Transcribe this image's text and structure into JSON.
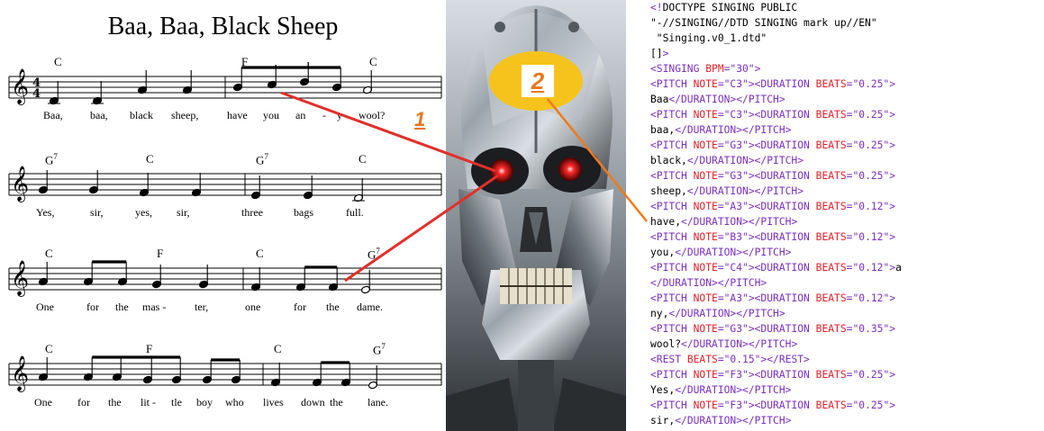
{
  "sheet": {
    "title": "Baa, Baa, Black Sheep",
    "time_signature": {
      "top": "4",
      "bottom": "4"
    },
    "rows": [
      {
        "chords": [
          {
            "label": "C",
            "sup": ""
          },
          {
            "label": "F",
            "sup": ""
          },
          {
            "label": "C",
            "sup": ""
          }
        ],
        "lyrics": [
          "Baa,",
          "baa,",
          "black",
          "sheep,",
          "have",
          "you",
          "an",
          "-",
          "y",
          "wool?"
        ]
      },
      {
        "chords": [
          {
            "label": "G",
            "sup": "7"
          },
          {
            "label": "C",
            "sup": ""
          },
          {
            "label": "G",
            "sup": "7"
          },
          {
            "label": "C",
            "sup": ""
          }
        ],
        "lyrics": [
          "Yes,",
          "sir,",
          "yes,",
          "sir,",
          "three",
          "bags",
          "full."
        ]
      },
      {
        "chords": [
          {
            "label": "C",
            "sup": ""
          },
          {
            "label": "F",
            "sup": ""
          },
          {
            "label": "C",
            "sup": ""
          },
          {
            "label": "G",
            "sup": "7"
          }
        ],
        "lyrics": [
          "One",
          "for",
          "the",
          "mas -",
          "ter,",
          "one",
          "for",
          "the",
          "dame."
        ]
      },
      {
        "chords": [
          {
            "label": "C",
            "sup": ""
          },
          {
            "label": "F",
            "sup": ""
          },
          {
            "label": "C",
            "sup": ""
          },
          {
            "label": "G",
            "sup": "7"
          }
        ],
        "lyrics": [
          "One",
          "for",
          "the",
          "lit -",
          "tle",
          "boy",
          "who",
          "lives",
          "down",
          "the",
          "lane."
        ]
      }
    ]
  },
  "markers": [
    {
      "label": "1",
      "color": "#e8761e"
    },
    {
      "label": "2",
      "color": "#e8761e",
      "badge_color": "#f5c31c"
    }
  ],
  "colors": {
    "tag": "#7a2fbf",
    "attribute": "#e0202a",
    "value": "#7a2fbf",
    "text": "#000000",
    "connector_red": "#e0302a",
    "connector_orange": "#f07a1a"
  },
  "robot": {
    "icon": "terminator-endoskeleton-image"
  },
  "xml_lines": [
    [
      {
        "t": "<!",
        "c": "tg"
      },
      {
        "t": "DOCTYPE SINGING PUBLIC",
        "c": "tx"
      }
    ],
    [
      {
        "t": "\"-//SINGING//DTD SINGING mark up//EN\"",
        "c": "tx"
      }
    ],
    [
      {
        "t": " \"Singing.v0_1.dtd\"",
        "c": "tx"
      }
    ],
    [
      {
        "t": "[]",
        "c": "tx"
      },
      {
        "t": ">",
        "c": "tg"
      }
    ],
    [
      {
        "t": "<SINGING ",
        "c": "tg"
      },
      {
        "t": "BPM",
        "c": "at"
      },
      {
        "t": "=\"30\">",
        "c": "av"
      }
    ],
    [
      {
        "t": "<PITCH ",
        "c": "tg"
      },
      {
        "t": "NOTE",
        "c": "at"
      },
      {
        "t": "=\"C3\"><DURATION ",
        "c": "av"
      },
      {
        "t": "BEATS",
        "c": "at"
      },
      {
        "t": "=\"0.25\">",
        "c": "av"
      }
    ],
    [
      {
        "t": "Baa",
        "c": "tx"
      },
      {
        "t": "</DURATION></PITCH>",
        "c": "tg"
      }
    ],
    [
      {
        "t": "<PITCH ",
        "c": "tg"
      },
      {
        "t": "NOTE",
        "c": "at"
      },
      {
        "t": "=\"C3\"><DURATION ",
        "c": "av"
      },
      {
        "t": "BEATS",
        "c": "at"
      },
      {
        "t": "=\"0.25\">",
        "c": "av"
      }
    ],
    [
      {
        "t": "baa,",
        "c": "tx"
      },
      {
        "t": "</DURATION></PITCH>",
        "c": "tg"
      }
    ],
    [
      {
        "t": "<PITCH ",
        "c": "tg"
      },
      {
        "t": "NOTE",
        "c": "at"
      },
      {
        "t": "=\"G3\"><DURATION ",
        "c": "av"
      },
      {
        "t": "BEATS",
        "c": "at"
      },
      {
        "t": "=\"0.25\">",
        "c": "av"
      }
    ],
    [
      {
        "t": "black,",
        "c": "tx"
      },
      {
        "t": "</DURATION></PITCH>",
        "c": "tg"
      }
    ],
    [
      {
        "t": "<PITCH ",
        "c": "tg"
      },
      {
        "t": "NOTE",
        "c": "at"
      },
      {
        "t": "=\"G3\"><DURATION ",
        "c": "av"
      },
      {
        "t": "BEATS",
        "c": "at"
      },
      {
        "t": "=\"0.25\">",
        "c": "av"
      }
    ],
    [
      {
        "t": "sheep,",
        "c": "tx"
      },
      {
        "t": "</DURATION></PITCH>",
        "c": "tg"
      }
    ],
    [
      {
        "t": "<PITCH ",
        "c": "tg"
      },
      {
        "t": "NOTE",
        "c": "at"
      },
      {
        "t": "=\"A3\"><DURATION ",
        "c": "av"
      },
      {
        "t": "BEATS",
        "c": "at"
      },
      {
        "t": "=\"0.12\">",
        "c": "av"
      }
    ],
    [
      {
        "t": "have,",
        "c": "tx"
      },
      {
        "t": "</DURATION></PITCH>",
        "c": "tg"
      }
    ],
    [
      {
        "t": "<PITCH ",
        "c": "tg"
      },
      {
        "t": "NOTE",
        "c": "at"
      },
      {
        "t": "=\"B3\"><DURATION ",
        "c": "av"
      },
      {
        "t": "BEATS",
        "c": "at"
      },
      {
        "t": "=\"0.12\">",
        "c": "av"
      }
    ],
    [
      {
        "t": "you,",
        "c": "tx"
      },
      {
        "t": "</DURATION></PITCH>",
        "c": "tg"
      }
    ],
    [
      {
        "t": "<PITCH ",
        "c": "tg"
      },
      {
        "t": "NOTE",
        "c": "at"
      },
      {
        "t": "=\"C4\"><DURATION ",
        "c": "av"
      },
      {
        "t": "BEATS",
        "c": "at"
      },
      {
        "t": "=\"0.12\">",
        "c": "av"
      },
      {
        "t": "a",
        "c": "tx"
      }
    ],
    [
      {
        "t": "</DURATION></PITCH>",
        "c": "tg"
      }
    ],
    [
      {
        "t": "<PITCH ",
        "c": "tg"
      },
      {
        "t": "NOTE",
        "c": "at"
      },
      {
        "t": "=\"A3\"><DURATION ",
        "c": "av"
      },
      {
        "t": "BEATS",
        "c": "at"
      },
      {
        "t": "=\"0.12\">",
        "c": "av"
      }
    ],
    [
      {
        "t": "ny,",
        "c": "tx"
      },
      {
        "t": "</DURATION></PITCH>",
        "c": "tg"
      }
    ],
    [
      {
        "t": "<PITCH ",
        "c": "tg"
      },
      {
        "t": "NOTE",
        "c": "at"
      },
      {
        "t": "=\"G3\"><DURATION ",
        "c": "av"
      },
      {
        "t": "BEATS",
        "c": "at"
      },
      {
        "t": "=\"0.35\">",
        "c": "av"
      }
    ],
    [
      {
        "t": "wool?",
        "c": "tx"
      },
      {
        "t": "</DURATION></PITCH>",
        "c": "tg"
      }
    ],
    [
      {
        "t": "<REST ",
        "c": "tg"
      },
      {
        "t": "BEATS",
        "c": "at"
      },
      {
        "t": "=\"0.15\"></REST>",
        "c": "av"
      }
    ],
    [
      {
        "t": "<PITCH ",
        "c": "tg"
      },
      {
        "t": "NOTE",
        "c": "at"
      },
      {
        "t": "=\"F3\"><DURATION ",
        "c": "av"
      },
      {
        "t": "BEATS",
        "c": "at"
      },
      {
        "t": "=\"0.25\">",
        "c": "av"
      }
    ],
    [
      {
        "t": "Yes,",
        "c": "tx"
      },
      {
        "t": "</DURATION></PITCH>",
        "c": "tg"
      }
    ],
    [
      {
        "t": "<PITCH ",
        "c": "tg"
      },
      {
        "t": "NOTE",
        "c": "at"
      },
      {
        "t": "=\"F3\"><DURATION ",
        "c": "av"
      },
      {
        "t": "BEATS",
        "c": "at"
      },
      {
        "t": "=\"0.25\">",
        "c": "av"
      }
    ],
    [
      {
        "t": "sir,",
        "c": "tx"
      },
      {
        "t": "</DURATION></PITCH>",
        "c": "tg"
      }
    ]
  ]
}
